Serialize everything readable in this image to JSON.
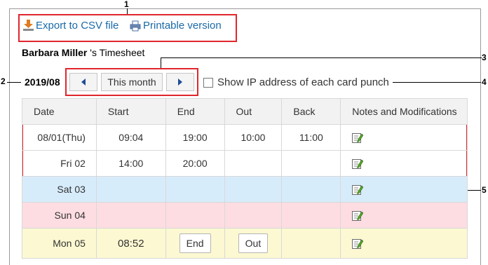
{
  "callouts": [
    "1",
    "2",
    "3",
    "4",
    "5"
  ],
  "toolbar": {
    "export_label": "Export to CSV file",
    "print_label": "Printable version"
  },
  "header": {
    "user_name": "Barbara Miller",
    "suffix": " 's Timesheet",
    "year_month": "2019/08",
    "this_month_label": "This month",
    "show_ip_label": "Show IP address of each card punch"
  },
  "table": {
    "columns": [
      "Date",
      "Start",
      "End",
      "Out",
      "Back",
      "Notes and Modifications"
    ],
    "rows": [
      {
        "date": "08/01(Thu)",
        "start": "09:04",
        "end": "19:00",
        "out": "10:00",
        "back": "11:00"
      },
      {
        "date": "Fri 02",
        "start": "14:00",
        "end": "20:00",
        "out": "",
        "back": ""
      },
      {
        "date": "Sat 03",
        "start": "",
        "end": "",
        "out": "",
        "back": ""
      },
      {
        "date": "Sun 04",
        "start": "",
        "end": "",
        "out": "",
        "back": ""
      },
      {
        "date": "Mon 05",
        "start": "08:52",
        "end_button": "End",
        "out_button": "Out",
        "back": ""
      }
    ]
  },
  "colors": {
    "callout_red": "#e0262d",
    "link": "#1a6aa8",
    "saturday": "#d7ecfb",
    "sunday": "#fddde2",
    "today": "#fcf8d1"
  }
}
